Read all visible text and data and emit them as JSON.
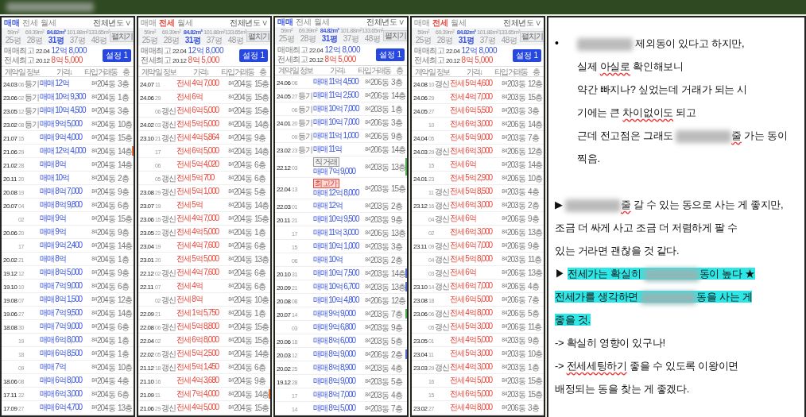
{
  "top_bar": {
    "redacted_title": true
  },
  "panels": [
    {
      "tabs": [
        {
          "label": "매매",
          "selected": true
        },
        {
          "label": "전세",
          "selected": false
        },
        {
          "label": "월세",
          "selected": false
        }
      ],
      "year_filter": "전체년도 ∨",
      "areas": [
        {
          "size": "59m²",
          "pyeong": "25평",
          "selected": false
        },
        {
          "size": "69.39m²",
          "pyeong": "28평",
          "selected": false
        },
        {
          "size": "84.82m²",
          "pyeong": "31평",
          "selected": true
        },
        {
          "size": "101.88m²",
          "pyeong": "37평",
          "selected": false
        },
        {
          "size": "133.65m²",
          "pyeong": "48평",
          "selected": false
        }
      ],
      "toggle_button": "펼치기",
      "summary": [
        {
          "label": "매매최고",
          "date": "22.04",
          "value": "12억 8,000",
          "kind": "sale"
        },
        {
          "label": "전세최고",
          "date": "20.12",
          "value": "8억 5,000",
          "kind": "jeonse"
        }
      ],
      "settings_button": "설정 1",
      "columns": [
        "계약",
        "일",
        "정보",
        "가격↓",
        "타입",
        "거래동",
        "층"
      ],
      "rows": [
        {
          "date": "24.03",
          "day": "06",
          "info": "등기",
          "price": "매매 12억",
          "type": "84",
          "dong": "204동",
          "floor": "3층"
        },
        {
          "date": "23.06",
          "day": "02",
          "info": "등기",
          "price": "매매 10억 9,300",
          "type": "84",
          "dong": "204동",
          "floor": "1층"
        },
        {
          "date": "23.05",
          "day": "12",
          "info": "등기",
          "price": "매매 10억 4,500",
          "type": "84",
          "dong": "204동",
          "floor": "3층"
        },
        {
          "date": "23.02",
          "day": "08",
          "info": "등기",
          "price": "매매 9억 5,000",
          "type": "84",
          "dong": "204동",
          "floor": "10층"
        },
        {
          "date": "21.07",
          "day": "15",
          "price": "매매 9억 4,000",
          "type": "84",
          "dong": "204동",
          "floor": "15층"
        },
        {
          "date": "21.06",
          "day": "29",
          "price": "매매 12억 4,000",
          "type": "84",
          "dong": "204동",
          "floor": "14층",
          "color": "#e8733a"
        },
        {
          "date": "21.02",
          "day": "28",
          "price": "매매 8억",
          "type": "84",
          "dong": "204동",
          "floor": "14층"
        },
        {
          "date": "20.11",
          "day": "20",
          "price": "매매 10억",
          "type": "84",
          "dong": "204동",
          "floor": "2층"
        },
        {
          "date": "20.08",
          "day": "19",
          "price": "매매 8억 7,000",
          "type": "84",
          "dong": "204동",
          "floor": "9층"
        },
        {
          "date": "20.07",
          "day": "04",
          "price": "매매 8억 9,800",
          "type": "84",
          "dong": "204동",
          "floor": "6층"
        },
        {
          "day": "02",
          "price": "매매 9억",
          "type": "84",
          "dong": "204동",
          "floor": "15층"
        },
        {
          "date": "20.06",
          "day": "20",
          "price": "매매 9억",
          "type": "84",
          "dong": "204동",
          "floor": "9층"
        },
        {
          "day": "17",
          "price": "매매 9억 2,400",
          "type": "84",
          "dong": "204동",
          "floor": "14층"
        },
        {
          "date": "20.02",
          "day": "21",
          "price": "매매 8억",
          "type": "84",
          "dong": "204동",
          "floor": "1층"
        },
        {
          "date": "19.12",
          "day": "12",
          "price": "매매 8억 5,000",
          "type": "84",
          "dong": "204동",
          "floor": "9층"
        },
        {
          "date": "19.10",
          "day": "10",
          "price": "매매 7억 9,000",
          "type": "84",
          "dong": "204동",
          "floor": "6층"
        },
        {
          "date": "19.08",
          "day": "07",
          "price": "매매 8억 1,500",
          "type": "84",
          "dong": "204동",
          "floor": "12층"
        },
        {
          "date": "19.06",
          "day": "27",
          "price": "매매 7억 9,500",
          "type": "84",
          "dong": "204동",
          "floor": "14층"
        },
        {
          "date": "18.08",
          "day": "30",
          "price": "매매 7억 9,000",
          "type": "84",
          "dong": "204동",
          "floor": "6층"
        },
        {
          "day": "19",
          "price": "매매 6억 8,000",
          "type": "84",
          "dong": "204동",
          "floor": "1층"
        },
        {
          "day": "18",
          "price": "매매 6억 8,500",
          "type": "84",
          "dong": "204동",
          "floor": "1층"
        },
        {
          "day": "09",
          "price": "매매 7억",
          "type": "84",
          "dong": "204동",
          "floor": "10층"
        },
        {
          "date": "18.06",
          "day": "08",
          "price": "매매 6억 8,000",
          "type": "84",
          "dong": "204동",
          "floor": "4층"
        },
        {
          "date": "17.11",
          "day": "22",
          "price": "매매 6억 3,000",
          "type": "84",
          "dong": "204동",
          "floor": "6층"
        },
        {
          "date": "17.09",
          "day": "27",
          "price": "매매 6억 4,700",
          "type": "84",
          "dong": "204동",
          "floor": "13층"
        }
      ]
    },
    {
      "tabs": [
        {
          "label": "매매",
          "selected": false
        },
        {
          "label": "전세",
          "selected": true
        },
        {
          "label": "월세",
          "selected": false
        }
      ],
      "year_filter": "전체년도 ∨",
      "areas": [
        {
          "size": "59m²",
          "pyeong": "25평",
          "selected": false
        },
        {
          "size": "69.39m²",
          "pyeong": "28평",
          "selected": false
        },
        {
          "size": "84.82m²",
          "pyeong": "31평",
          "selected": true
        },
        {
          "size": "101.88m²",
          "pyeong": "37평",
          "selected": false
        },
        {
          "size": "133.65m²",
          "pyeong": "48평",
          "selected": false
        }
      ],
      "toggle_button": "펼치기",
      "summary": [
        {
          "label": "매매최고",
          "date": "22.04",
          "value": "12억 8,000",
          "kind": "sale"
        },
        {
          "label": "전세최고",
          "date": "20.12",
          "value": "8억 5,000",
          "kind": "jeonse"
        }
      ],
      "settings_button": "설정 1",
      "columns": [
        "계약",
        "일",
        "정보",
        "가격↓",
        "타입",
        "거래동",
        "층"
      ],
      "rows": [
        {
          "date": "24.07",
          "day": "11",
          "price": "전세 4억 7,000",
          "type": "84",
          "dong": "204동",
          "floor": "15층"
        },
        {
          "date": "24.06",
          "day": "29",
          "price": "전세 6억",
          "type": "84",
          "dong": "204동",
          "floor": "15층"
        },
        {
          "day": "06",
          "info": "갱신",
          "price": "전세 6억 5,000",
          "type": "84",
          "dong": "204동",
          "floor": "15층"
        },
        {
          "date": "24.02",
          "day": "03",
          "info": "갱신",
          "price": "전세 5억 5,000",
          "type": "84",
          "dong": "204동",
          "floor": "14층"
        },
        {
          "date": "23.10",
          "day": "21",
          "info": "갱신",
          "price": "전세 4억 5,864",
          "type": "84",
          "dong": "204동",
          "floor": "9층"
        },
        {
          "day": "17",
          "price": "전세 6억 5,000",
          "type": "84",
          "dong": "204동",
          "floor": "14층"
        },
        {
          "day": "06",
          "price": "전세 5억 4,020",
          "type": "84",
          "dong": "204동",
          "floor": "6층"
        },
        {
          "day": "05",
          "info": "갱신",
          "price": "전세 5억 700",
          "type": "84",
          "dong": "204동",
          "floor": "6층"
        },
        {
          "date": "23.08",
          "day": "29",
          "info": "갱신",
          "price": "전세 5억 1,000",
          "type": "84",
          "dong": "204동",
          "floor": "5층"
        },
        {
          "date": "23.07",
          "day": "19",
          "price": "전세 5억",
          "type": "84",
          "dong": "204동",
          "floor": "14층"
        },
        {
          "date": "23.06",
          "day": "15",
          "info": "갱신",
          "price": "전세 4억 7,000",
          "type": "84",
          "dong": "204동",
          "floor": "15층"
        },
        {
          "date": "23.05",
          "day": "22",
          "info": "갱신",
          "price": "전세 4억 5,000",
          "type": "84",
          "dong": "204동",
          "floor": "1층"
        },
        {
          "date": "23.04",
          "day": "19",
          "price": "전세 4억 7,600",
          "type": "84",
          "dong": "204동",
          "floor": "6층"
        },
        {
          "date": "23.01",
          "day": "20",
          "price": "전세 5억 5,000",
          "type": "84",
          "dong": "204동",
          "floor": "13층"
        },
        {
          "date": "22.12",
          "day": "02",
          "info": "갱신",
          "price": "전세 4억 7,600",
          "type": "84",
          "dong": "204동",
          "floor": "6층"
        },
        {
          "date": "22.11",
          "day": "07",
          "price": "전세 4억",
          "type": "84",
          "dong": "204동",
          "floor": "6층"
        },
        {
          "day": "02",
          "info": "갱신",
          "price": "전세 8억",
          "type": "84",
          "dong": "204동",
          "floor": "10층"
        },
        {
          "date": "22.09",
          "day": "21",
          "price": "전세 1억 5,750",
          "type": "84",
          "dong": "204동",
          "floor": "1층"
        },
        {
          "date": "22.08",
          "day": "06",
          "info": "갱신",
          "price": "전세 5억 8,800",
          "type": "84",
          "dong": "204동",
          "floor": "15층"
        },
        {
          "date": "22.04",
          "day": "02",
          "price": "전세 6억 8,000",
          "type": "84",
          "dong": "204동",
          "floor": "15층"
        },
        {
          "date": "22.02",
          "day": "05",
          "info": "갱신",
          "price": "전세 5억 2,500",
          "type": "84",
          "dong": "204동",
          "floor": "14층"
        },
        {
          "date": "21.12",
          "day": "18",
          "info": "갱신",
          "price": "전세 5억 1,450",
          "type": "84",
          "dong": "204동",
          "floor": "6층"
        },
        {
          "date": "21.10",
          "day": "16",
          "price": "전세 4억 3,680",
          "type": "84",
          "dong": "204동",
          "floor": "9층"
        },
        {
          "date": "21.09",
          "day": "11",
          "price": "전세 7억 4,000",
          "type": "84",
          "dong": "204동",
          "floor": "14층",
          "color": "#e8733a"
        },
        {
          "date": "21.06",
          "day": "29",
          "info": "갱신",
          "price": "전세 4억 5,000",
          "type": "84",
          "dong": "204동",
          "floor": "15층"
        }
      ]
    },
    {
      "tabs": [
        {
          "label": "매매",
          "selected": true
        },
        {
          "label": "전세",
          "selected": false
        },
        {
          "label": "월세",
          "selected": false
        }
      ],
      "year_filter": "전체년도 ∨",
      "areas": [
        {
          "size": "59m²",
          "pyeong": "25평",
          "selected": false
        },
        {
          "size": "69.39m²",
          "pyeong": "28평",
          "selected": false
        },
        {
          "size": "84.82m²",
          "pyeong": "31평",
          "selected": true
        },
        {
          "size": "101.88m²",
          "pyeong": "37평",
          "selected": false
        },
        {
          "size": "133.65m²",
          "pyeong": "48평",
          "selected": false
        }
      ],
      "toggle_button": "펼치기",
      "summary": [
        {
          "label": "매매최고",
          "date": "22.04",
          "value": "12억 8,000",
          "kind": "sale"
        },
        {
          "label": "전세최고",
          "date": "20.12",
          "value": "8억 5,000",
          "kind": "jeonse"
        }
      ],
      "settings_button": "설정 1",
      "columns": [
        "계약",
        "일",
        "정보",
        "가격↓",
        "타입",
        "거래동",
        "층"
      ],
      "rows": [
        {
          "date": "24.06",
          "day": "06",
          "price": "매매 11억 4,500",
          "type": "84",
          "dong": "206동",
          "floor": "3층"
        },
        {
          "date": "24.05",
          "day": "27",
          "info": "등기",
          "price": "매매 11억 2,500",
          "type": "84",
          "dong": "206동",
          "floor": "14층"
        },
        {
          "day": "06",
          "info": "등기",
          "price": "매매 10억 7,000",
          "type": "84",
          "dong": "203동",
          "floor": "1층"
        },
        {
          "date": "24.01",
          "day": "20",
          "info": "등기",
          "price": "매매 10억 7,000",
          "type": "84",
          "dong": "206동",
          "floor": "3층"
        },
        {
          "day": "09",
          "info": "등기",
          "price": "매매 11억 1,000",
          "type": "84",
          "dong": "206동",
          "floor": "9층"
        },
        {
          "date": "23.02",
          "day": "23",
          "info": "등기",
          "price": "매매 11억",
          "type": "84",
          "dong": "206동",
          "floor": "14층"
        },
        {
          "date": "22.12",
          "day": "03",
          "tag": {
            "text": "직거래",
            "kind": "plain"
          },
          "price": "매매 7억 9,000",
          "type": "84",
          "dong": "203동",
          "floor": "13층",
          "color": "#4caf50"
        },
        {
          "date": "22.04",
          "day": "13",
          "tag": {
            "text": "최고가",
            "kind": "highlight"
          },
          "price": "매매 12억 8,000",
          "type": "84",
          "dong": "203동",
          "floor": "15층"
        },
        {
          "date": "22.03",
          "day": "01",
          "price": "매매 12억",
          "type": "84",
          "dong": "203동",
          "floor": "2층"
        },
        {
          "date": "20.11",
          "day": "21",
          "price": "매매 10억 9,500",
          "type": "84",
          "dong": "203동",
          "floor": "9층"
        },
        {
          "day": "17",
          "price": "매매 11억 3,000",
          "type": "84",
          "dong": "206동",
          "floor": "13층"
        },
        {
          "day": "15",
          "price": "매매 10억 1,000",
          "type": "84",
          "dong": "203동",
          "floor": "3층"
        },
        {
          "day": "06",
          "price": "매매 10억",
          "type": "84",
          "dong": "203동",
          "floor": "2층"
        },
        {
          "date": "20.10",
          "day": "31",
          "price": "매매 10억 7,500",
          "type": "84",
          "dong": "203동",
          "floor": "14층",
          "color": "#5b6fd6"
        },
        {
          "date": "20.09",
          "day": "21",
          "price": "매매 10억 6,700",
          "type": "84",
          "dong": "203동",
          "floor": "13층",
          "color": "#5b6fd6"
        },
        {
          "date": "20.08",
          "day": "08",
          "price": "매매 10억 4,800",
          "type": "84",
          "dong": "206동",
          "floor": "12층"
        },
        {
          "date": "20.07",
          "day": "14",
          "price": "매매 9억 9,000",
          "type": "84",
          "dong": "203동",
          "floor": "7층",
          "color": "#4caf50"
        },
        {
          "day": "03",
          "price": "매매 9억 6,800",
          "type": "84",
          "dong": "203동",
          "floor": "9층"
        },
        {
          "date": "20.06",
          "day": "18",
          "price": "매매 8억 6,000",
          "type": "84",
          "dong": "203동",
          "floor": "5층"
        },
        {
          "date": "20.03",
          "day": "12",
          "price": "매매 8억 9,000",
          "type": "84",
          "dong": "206동",
          "floor": "2층",
          "color": "#5b6fd6"
        },
        {
          "date": "20.02",
          "day": "25",
          "price": "매매 8억 8,900",
          "type": "84",
          "dong": "203동",
          "floor": "4층"
        },
        {
          "date": "19.12",
          "day": "28",
          "price": "매매 8억 9,000",
          "type": "84",
          "dong": "203동",
          "floor": "5층"
        },
        {
          "day": "17",
          "price": "매매 8억 7,000",
          "type": "84",
          "dong": "203동",
          "floor": "4층"
        },
        {
          "day": "14",
          "price": "매매 8억 5,000",
          "type": "84",
          "dong": "203동",
          "floor": "7층"
        }
      ]
    },
    {
      "tabs": [
        {
          "label": "매매",
          "selected": false
        },
        {
          "label": "전세",
          "selected": true
        },
        {
          "label": "월세",
          "selected": false
        }
      ],
      "year_filter": "전체년도 ∨",
      "areas": [
        {
          "size": "59m²",
          "pyeong": "25평",
          "selected": false
        },
        {
          "size": "69.39m²",
          "pyeong": "28평",
          "selected": false
        },
        {
          "size": "84.82m²",
          "pyeong": "31평",
          "selected": true
        },
        {
          "size": "101.88m²",
          "pyeong": "37평",
          "selected": false
        },
        {
          "size": "133.65m²",
          "pyeong": "48평",
          "selected": false
        }
      ],
      "toggle_button": "펼치기",
      "summary": [
        {
          "label": "매매최고",
          "date": "22.04",
          "value": "12억 8,000",
          "kind": "sale"
        },
        {
          "label": "전세최고",
          "date": "20.12",
          "value": "8억 5,000",
          "kind": "jeonse"
        }
      ],
      "settings_button": "설정 1",
      "columns": [
        "계약",
        "일",
        "정보",
        "가격↓",
        "타입",
        "거래동",
        "층"
      ],
      "rows": [
        {
          "date": "24.08",
          "day": "10",
          "info": "갱신",
          "price": "전세 5억 4,600",
          "type": "84",
          "dong": "203동",
          "floor": "12층"
        },
        {
          "date": "24.06",
          "day": "29",
          "price": "전세 4억 7,000",
          "type": "84",
          "dong": "203동",
          "floor": "15층"
        },
        {
          "date": "24.05",
          "day": "27",
          "price": "전세 6억 5,500",
          "type": "84",
          "dong": "203동",
          "floor": "3층"
        },
        {
          "day": "10",
          "price": "전세 6억 3,000",
          "type": "84",
          "dong": "206동",
          "floor": "14층"
        },
        {
          "date": "24.04",
          "day": "05",
          "price": "전세 5억 9,000",
          "type": "84",
          "dong": "203동",
          "floor": "7층"
        },
        {
          "date": "24.03",
          "day": "29",
          "info": "갱신",
          "price": "전세 6억 3,000",
          "type": "84",
          "dong": "206동",
          "floor": "12층"
        },
        {
          "day": "15",
          "price": "전세 6억",
          "type": "84",
          "dong": "203동",
          "floor": "14층"
        },
        {
          "date": "24.01",
          "day": "23",
          "price": "전세 5억 2,900",
          "type": "84",
          "dong": "206동",
          "floor": "10층"
        },
        {
          "day": "11",
          "info": "갱신",
          "price": "전세 5억 8,500",
          "type": "84",
          "dong": "203동",
          "floor": "4층"
        },
        {
          "date": "23.12",
          "day": "16",
          "info": "갱신",
          "price": "전세 6억 3,000",
          "type": "84",
          "dong": "203동",
          "floor": "2층"
        },
        {
          "day": "04",
          "info": "갱신",
          "price": "전세 6억",
          "type": "84",
          "dong": "206동",
          "floor": "9층"
        },
        {
          "day": "02",
          "price": "전세 6억 3,000",
          "type": "84",
          "dong": "206동",
          "floor": "13층"
        },
        {
          "date": "23.11",
          "day": "09",
          "info": "갱신",
          "price": "전세 6억 7,000",
          "type": "84",
          "dong": "206동",
          "floor": "9층"
        },
        {
          "day": "04",
          "info": "갱신",
          "price": "전세 5억 8,000",
          "type": "84",
          "dong": "203동",
          "floor": "11층"
        },
        {
          "day": "03",
          "info": "갱신",
          "price": "전세 6억",
          "type": "84",
          "dong": "206동",
          "floor": "13층"
        },
        {
          "date": "23.10",
          "day": "14",
          "info": "갱신",
          "price": "전세 6억 7,000",
          "type": "84",
          "dong": "206동",
          "floor": "4층"
        },
        {
          "date": "23.08",
          "day": "18",
          "price": "전세 6억 5,000",
          "type": "84",
          "dong": "206동",
          "floor": "7층"
        },
        {
          "date": "23.06",
          "day": "06",
          "info": "갱신",
          "price": "전세 4억 8,000",
          "type": "84",
          "dong": "206동",
          "floor": "5층"
        },
        {
          "day": "05",
          "info": "갱신",
          "price": "전세 5억 3,000",
          "type": "84",
          "dong": "206동",
          "floor": "11층"
        },
        {
          "date": "23.05",
          "day": "01",
          "price": "전세 4억 5,000",
          "type": "84",
          "dong": "203동",
          "floor": "9층"
        },
        {
          "date": "23.04",
          "day": "11",
          "price": "전세 5억 3,000",
          "type": "84",
          "dong": "203동",
          "floor": "10층"
        },
        {
          "date": "23.03",
          "day": "29",
          "info": "갱신",
          "price": "전세 4억 3,000",
          "type": "84",
          "dong": "203동",
          "floor": "1층"
        },
        {
          "day": "16",
          "price": "전세 4억 5,000",
          "type": "84",
          "dong": "203동",
          "floor": "15층"
        },
        {
          "day": "15",
          "price": "전세 6억 5,000",
          "type": "84",
          "dong": "203동",
          "floor": "15층"
        },
        {
          "date": "23.02",
          "day": "27",
          "price": "전세 4억 8,000",
          "type": "84",
          "dong": "206동",
          "floor": "3층"
        }
      ]
    }
  ],
  "notes": [
    {
      "kind": "bullet",
      "marker": "•",
      "lines": [
        [
          {
            "kind": "redacted"
          },
          {
            "kind": "text",
            "text": " 제외동이 있다고 하지만,"
          }
        ],
        [
          {
            "kind": "text",
            "text": "실제 "
          },
          {
            "kind": "text",
            "text": "아실로",
            "misspelled": true
          },
          {
            "kind": "text",
            "text": " 확인해보니"
          }
        ],
        [
          {
            "kind": "text",
            "text": "약간 빠지나? 싶었는데 거래가 되는 시"
          }
        ],
        [
          {
            "kind": "text",
            "text": "기에는 큰 "
          },
          {
            "kind": "text",
            "text": "차이없이도",
            "misspelled": true
          },
          {
            "kind": "text",
            "text": " 되고"
          }
        ],
        [
          {
            "kind": "text",
            "text": "근데 전고점은 그래도 "
          },
          {
            "kind": "redacted"
          },
          {
            "kind": "text",
            "text": "줄",
            "misspelled": true
          },
          {
            "kind": "text",
            "text": " 가는 동이"
          }
        ],
        [
          {
            "kind": "text",
            "text": "찍음."
          }
        ]
      ]
    },
    {
      "kind": "plain",
      "lines": [
        [
          {
            "kind": "text",
            "text": "▶ "
          },
          {
            "kind": "redacted"
          },
          {
            "kind": "text",
            "text": "줄",
            "misspelled": true
          },
          {
            "kind": "text",
            "text": " 갈 수 있는 동으로 사는 게 좋지만,"
          }
        ],
        [
          {
            "kind": "text",
            "text": "조금 더 싸게 사고 조금 더 저렴하게 팔 수"
          }
        ],
        [
          {
            "kind": "text",
            "text": "있는 거라면 괜찮을 것 같다."
          }
        ],
        [
          {
            "kind": "text",
            "text": "▶ "
          },
          {
            "kind": "text",
            "text": "전세가는 확실히 ",
            "highlighted": true
          },
          {
            "kind": "redacted",
            "highlighted": true
          },
          {
            "kind": "text",
            "text": "동이 높다 ★",
            "highlighted": true
          }
        ],
        [
          {
            "kind": "text",
            "text": "전세가를 생각하면 ",
            "highlighted": true
          },
          {
            "kind": "redacted",
            "highlighted": true
          },
          {
            "kind": "text",
            "text": "동을 사는 게",
            "highlighted": true
          }
        ],
        [
          {
            "kind": "text",
            "text": "좋을 것.",
            "highlighted": true
          }
        ],
        [
          {
            "kind": "text",
            "text": "-> 확실히 영향이 있구나!"
          }
        ],
        [
          {
            "kind": "text",
            "text": "-> "
          },
          {
            "kind": "text",
            "text": "전세세팅하기",
            "misspelled": true
          },
          {
            "kind": "text",
            "text": " 좋을 수 있도록 이왕이면"
          }
        ],
        [
          {
            "kind": "text",
            "text": "배정되는 동을 찾는 게 좋겠다."
          }
        ]
      ]
    }
  ]
}
